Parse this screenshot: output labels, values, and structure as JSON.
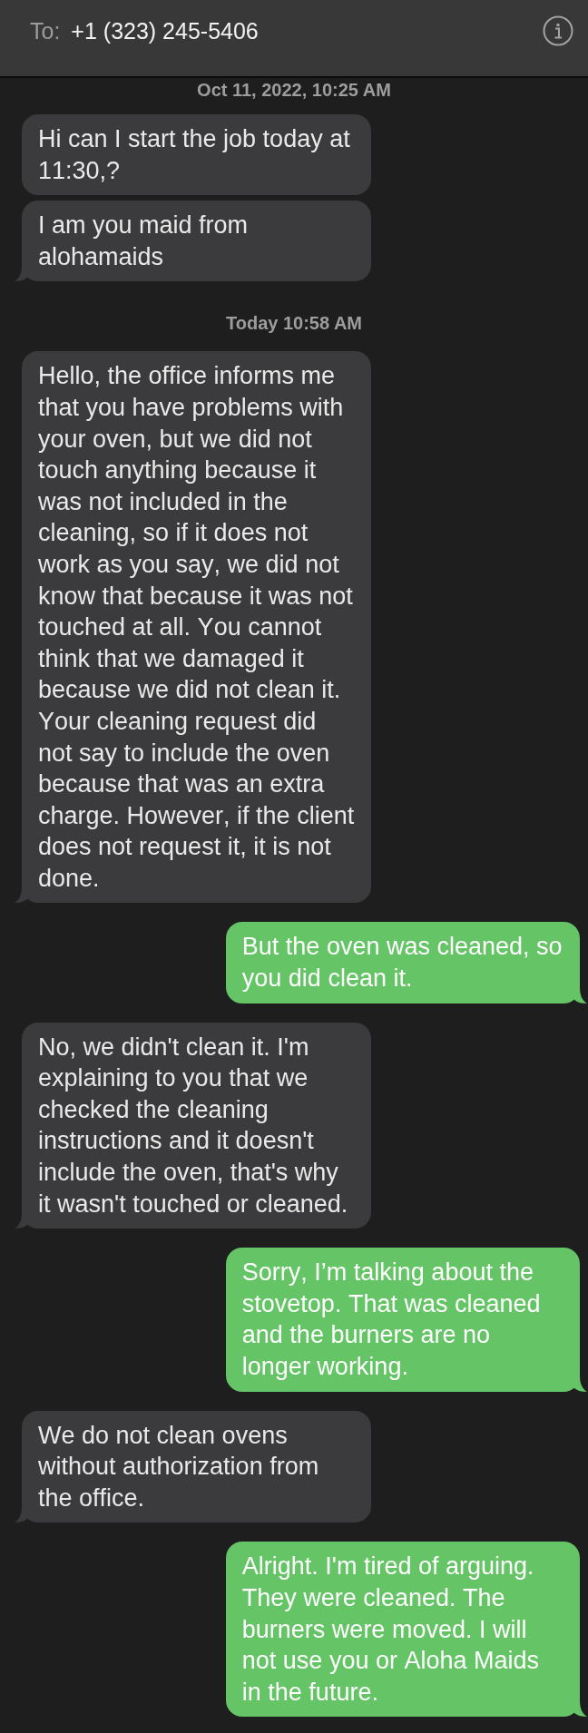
{
  "header": {
    "to_label": "To:",
    "recipient": "+1 (323) 245-5406"
  },
  "messages": [
    {
      "kind": "timestamp",
      "text": "Oct 11, 2022, 10:25 AM"
    },
    {
      "kind": "received",
      "text": "Hi can I start the job today at 11:30,?",
      "tail": false
    },
    {
      "kind": "received",
      "text": "I am you maid from alohamaids",
      "tail": true
    },
    {
      "kind": "timestamp",
      "text": "Today 10:58 AM"
    },
    {
      "kind": "received",
      "text": "Hello, the office informs me that you have problems with your oven, but we did not touch anything because it was not included in the cleaning, so if it does not work as you say, we did not know that because it was not touched at all. You cannot think that we damaged it because we did not clean it. Your cleaning request did not say to include the oven because that was an extra charge. However, if the client does not request it, it is not done.",
      "tail": true
    },
    {
      "kind": "sent",
      "text": "But the oven was cleaned, so you did clean it.",
      "tail": true
    },
    {
      "kind": "received",
      "text": "No, we didn't clean it. I'm explaining to you that we checked the cleaning instructions and it doesn't include the oven, that's why it wasn't touched or cleaned.",
      "tail": true
    },
    {
      "kind": "sent",
      "text": "Sorry, I’m talking about the stovetop. That was cleaned and the burners are no longer working.",
      "tail": true
    },
    {
      "kind": "received",
      "text": "We do not clean ovens without authorization from the office.",
      "tail": true
    },
    {
      "kind": "sent",
      "text": "Alright. I'm tired of arguing. They were cleaned. The burners were moved. I will not use you or Aloha Maids in the future.",
      "tail": true
    }
  ]
}
